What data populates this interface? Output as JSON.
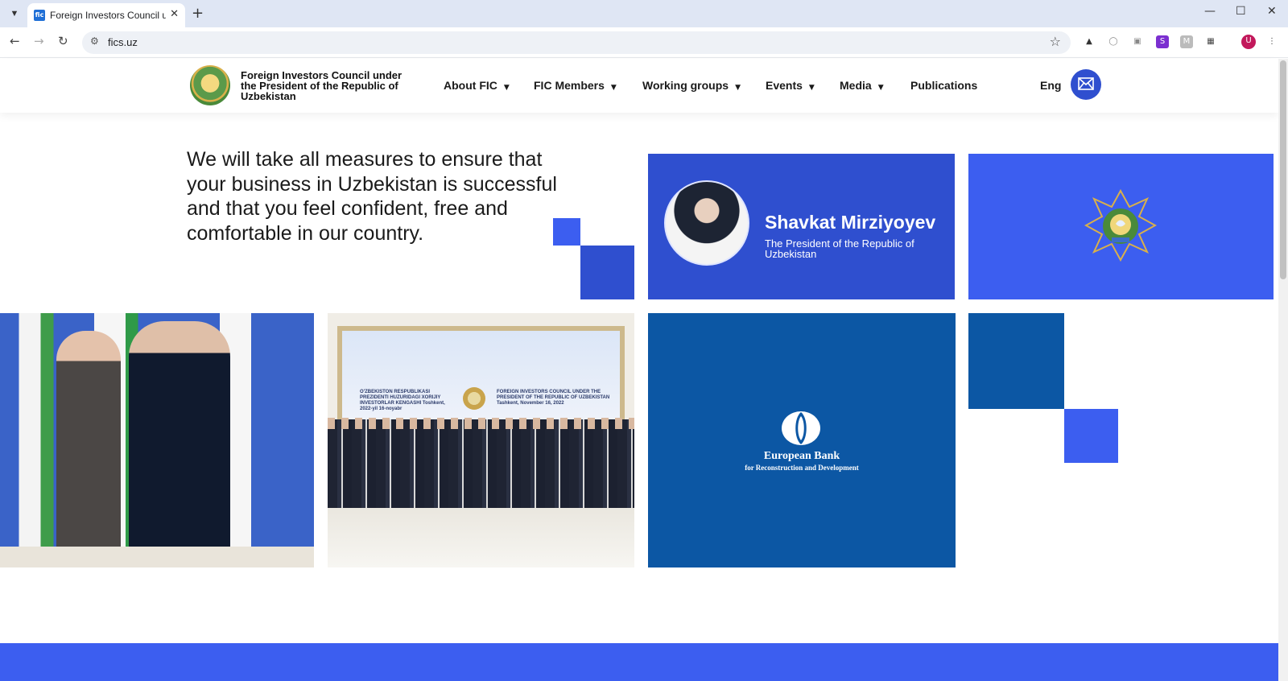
{
  "browser": {
    "tab_title": "Foreign Investors Council under the President of the Republic of Uzbekistan",
    "favicon_text": "fic",
    "url": "fics.uz",
    "extension_s": "S",
    "extension_m": "M",
    "profile_initial": "U"
  },
  "header": {
    "logo_text": "Foreign Investors Council under the President of the Republic of Uzbekistan",
    "menu": [
      {
        "label": "About FIC"
      },
      {
        "label": "FIC Members"
      },
      {
        "label": "Working groups"
      },
      {
        "label": "Events"
      },
      {
        "label": "Media"
      },
      {
        "label": "Publications"
      }
    ],
    "language": "Eng"
  },
  "hero": {
    "quote": "We will take all measures to ensure that your business in Uzbekistan is successful and that you feel confident, free and comfortable in our country.",
    "president_name": "Shavkat Mirziyoyev",
    "president_role": "The President of the Republic of Uzbekistan"
  },
  "photos": {
    "banner_left": "O'ZBEKISTON RESPUBLIKASI PREZIDENTI HUZURIDAGI XORIJIY INVESTORLAR KENGASHI Toshkent, 2022-yil 16-noyabr",
    "banner_right": "FOREIGN INVESTORS COUNCIL UNDER THE PRESIDENT OF THE REPUBLIC OF UZBEKISTAN Tashkent, November 16, 2022"
  },
  "partner": {
    "name": "European Bank",
    "subtitle": "for Reconstruction and Development"
  },
  "colors": {
    "primary_blue": "#2f4fcf",
    "bright_blue": "#3c5ef0",
    "ebrd_blue": "#0c57a4"
  }
}
